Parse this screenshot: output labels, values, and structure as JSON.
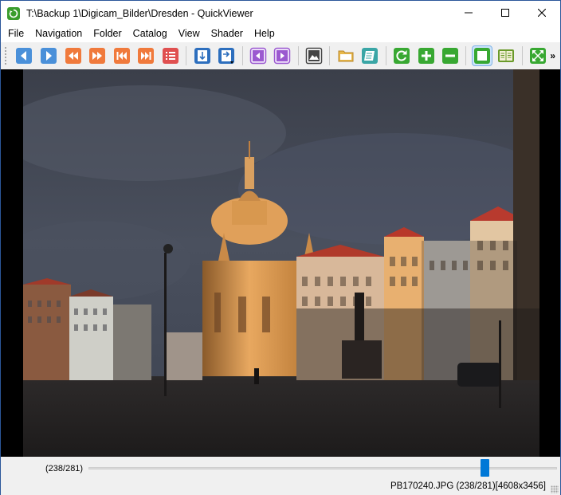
{
  "window": {
    "title": "T:\\Backup 1\\Digicam_Bilder\\Dresden - QuickViewer",
    "app_icon": "quickviewer-refresh-icon",
    "controls": [
      "minimize-icon",
      "maximize-icon",
      "close-icon"
    ]
  },
  "menu": [
    "File",
    "Navigation",
    "Folder",
    "Catalog",
    "View",
    "Shader",
    "Help"
  ],
  "toolbar": {
    "buttons": [
      {
        "name": "prev-image-icon",
        "color": "#4a90d9"
      },
      {
        "name": "next-image-icon",
        "color": "#4a90d9"
      },
      {
        "name": "rewind-icon",
        "color": "#f07a3c"
      },
      {
        "name": "fast-forward-icon",
        "color": "#f07a3c"
      },
      {
        "name": "first-image-icon",
        "color": "#f07a3c"
      },
      {
        "name": "last-image-icon",
        "color": "#f07a3c"
      },
      {
        "name": "list-icon",
        "color": "#e05050"
      },
      {
        "name": "spread-view-icon",
        "color": "#2d6fbe"
      },
      {
        "name": "spread-menu-icon",
        "color": "#2d6fbe"
      },
      {
        "name": "prev-volume-icon",
        "color": "#9b59d0"
      },
      {
        "name": "next-volume-icon",
        "color": "#9b59d0"
      },
      {
        "name": "thumbnail-panel-icon",
        "color": "#444444"
      },
      {
        "name": "open-folder-icon",
        "color": "#e8b84a"
      },
      {
        "name": "catalog-icon",
        "color": "#3aa6a6"
      },
      {
        "name": "rotate-icon",
        "color": "#38a832"
      },
      {
        "name": "zoom-in-icon",
        "color": "#38a832"
      },
      {
        "name": "zoom-out-icon",
        "color": "#38a832"
      },
      {
        "name": "fit-window-icon",
        "color": "#38a832"
      },
      {
        "name": "book-view-icon",
        "color": "#6a9a2a"
      },
      {
        "name": "fullscreen-icon",
        "color": "#38a832"
      }
    ],
    "overflow_label": "»"
  },
  "status": {
    "position_label": "(238/281)",
    "slider_progress": 0.8469,
    "file_info": "PB170240.JPG (238/281)[4608x3456]"
  },
  "colors": {
    "accent": "#0078d7",
    "titlebar_bg": "#ffffff",
    "toolbar_bg": "#f0f0f0"
  }
}
